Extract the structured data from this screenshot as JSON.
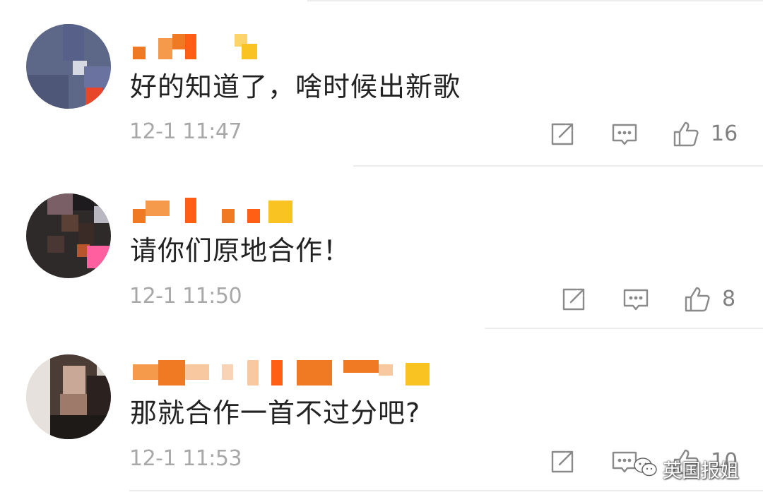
{
  "comments": [
    {
      "text": "好的知道了，啥时候出新歌",
      "time": "12-1 11:47",
      "likes": "16"
    },
    {
      "text": "请你们原地合作！",
      "time": "12-1 11:50",
      "likes": "8"
    },
    {
      "text": "那就合作一首不过分吧?",
      "time": "12-1 11:53",
      "likes": "10"
    }
  ],
  "watermark": {
    "text": "英国报姐",
    "icon": "wechat-icon"
  },
  "icons": {
    "repost": "share-icon",
    "comment": "comment-icon",
    "like": "thumbs-up-icon"
  },
  "colors": {
    "comment_text": "#222222",
    "meta_text": "#a8a8a8",
    "icon_stroke": "#8a8a8a",
    "username_orange": "#f07a24",
    "username_yellow": "#f9c322"
  }
}
